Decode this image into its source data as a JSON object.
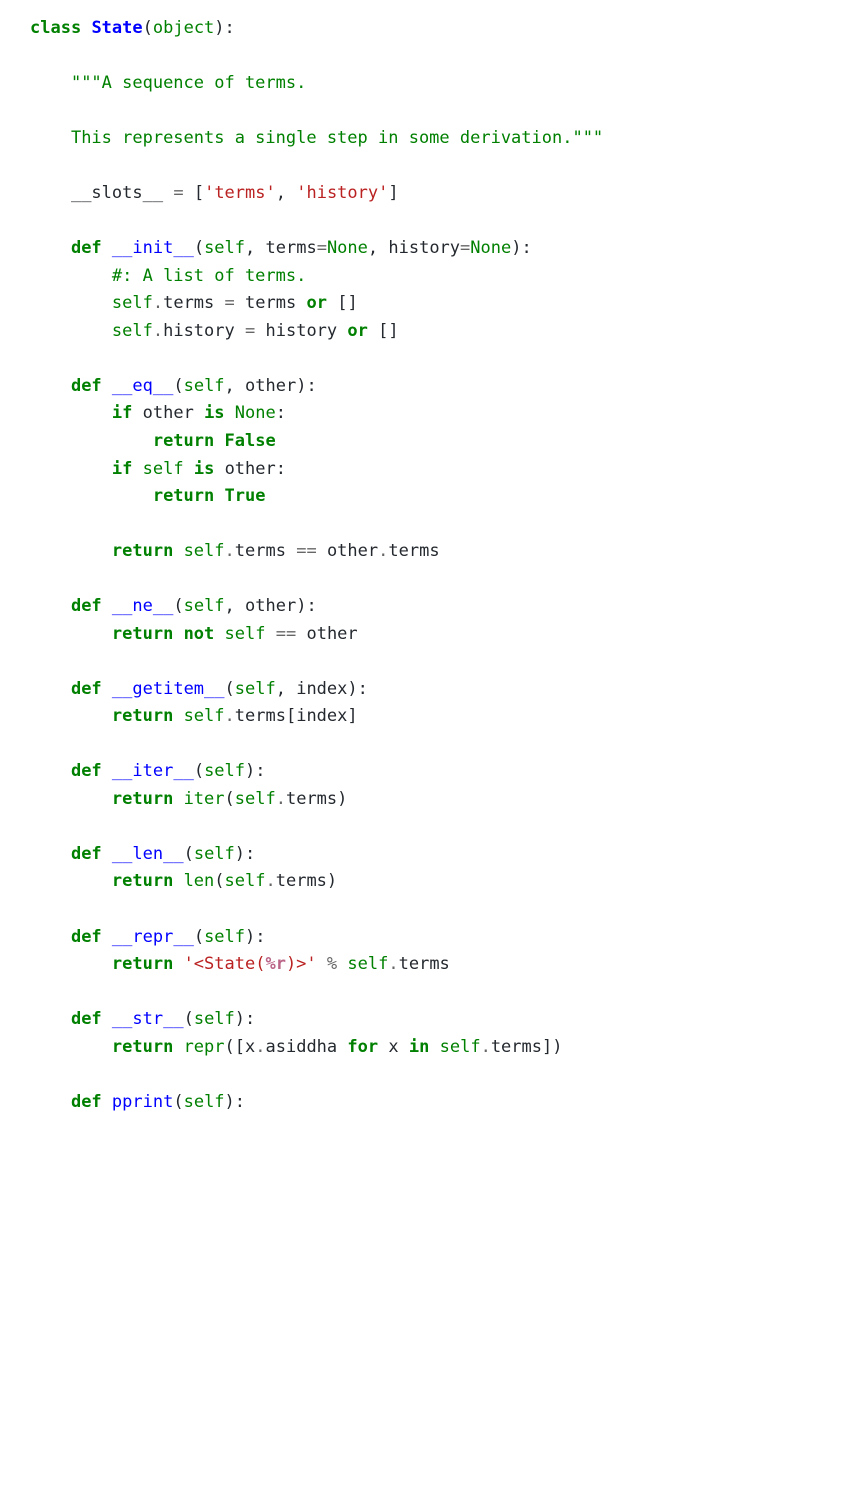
{
  "code": {
    "class_kw": "class",
    "class_name": "State",
    "object_builtin": "object",
    "docstring_open": "\"\"\"A sequence of terms.",
    "docstring_body": "This represents a single step in some derivation.\"\"\"",
    "slots_name": "__slots__",
    "slots_eq": "=",
    "slots_lb": "[",
    "slots_v1": "'terms'",
    "slots_comma": ",",
    "slots_v2": "'history'",
    "slots_rb": "]",
    "def_kw": "def",
    "init_name": "__init__",
    "init_params_open": "(",
    "self": "self",
    "comma": ",",
    "terms_param": "terms",
    "eq": "=",
    "none": "None",
    "history_param": "history",
    "params_close": "):",
    "comment_list": "#: A list of terms.",
    "or_kw": "or",
    "return_kw": "return",
    "if_kw": "if",
    "is_kw": "is",
    "not_kw": "not",
    "for_kw": "for",
    "in_kw": "in",
    "false": "False",
    "true": "True",
    "eq_name": "__eq__",
    "ne_name": "__ne__",
    "getitem_name": "__getitem__",
    "iter_name": "__iter__",
    "len_name": "__len__",
    "repr_name": "__repr__",
    "str_name": "__str__",
    "pprint_name": "pprint",
    "other": "other",
    "index": "index",
    "terms_attr": "terms",
    "history_attr": "history",
    "iter_builtin": "iter",
    "len_builtin": "len",
    "repr_builtin": "repr",
    "repr_str_pre": "'<State(",
    "repr_str_fmt": "%r",
    "repr_str_post": ")>'",
    "percent": "%",
    "empty_list": "[]",
    "dot": ".",
    "x": "x",
    "asiddha": "asiddha",
    "colon": ":",
    "dbl_eq": "=="
  }
}
